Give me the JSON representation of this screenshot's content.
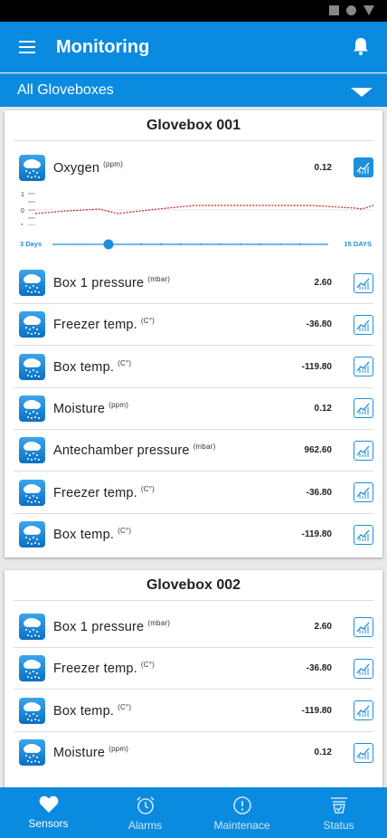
{
  "app": {
    "title": "Monitoring"
  },
  "filter": {
    "label": "All Gloveboxes"
  },
  "gloveboxes": [
    {
      "title": "Glovebox 001",
      "featured": {
        "name": "Oxygen",
        "unit": "(ppm)",
        "value": "0.12"
      },
      "graph": {
        "y_ticks": [
          "1",
          "0",
          "-1"
        ]
      },
      "slider": {
        "min_label": "3 Days",
        "max_label": "15 DAYS",
        "level": 0.2
      },
      "sensors": [
        {
          "name": "Box 1 pressure",
          "unit": "(mbar)",
          "value": "2.60"
        },
        {
          "name": "Freezer temp.",
          "unit": "(C°)",
          "value": "-36.80"
        },
        {
          "name": "Box temp.",
          "unit": "(C°)",
          "value": "-119.80"
        },
        {
          "name": "Moisture",
          "unit": "(ppm)",
          "value": "0.12"
        },
        {
          "name": "Antechamber pressure",
          "unit": "(mbar)",
          "value": "962.60"
        },
        {
          "name": "Freezer temp.",
          "unit": "(C°)",
          "value": "-36.80"
        },
        {
          "name": "Box temp.",
          "unit": "(C°)",
          "value": "-119.80"
        }
      ]
    },
    {
      "title": "Glovebox 002",
      "sensors": [
        {
          "name": "Box 1 pressure",
          "unit": "(mbar)",
          "value": "2.60"
        },
        {
          "name": "Freezer temp.",
          "unit": "(C°)",
          "value": "-36.80"
        },
        {
          "name": "Box temp.",
          "unit": "(C°)",
          "value": "-119.80"
        },
        {
          "name": "Moisture",
          "unit": "(ppm)",
          "value": "0.12"
        }
      ]
    }
  ],
  "nav": [
    {
      "label": "Sensors",
      "icon": "heart-icon"
    },
    {
      "label": "Alarms",
      "icon": "alarm-clock-icon"
    },
    {
      "label": "Maintenace",
      "icon": "alert-circle-icon"
    },
    {
      "label": "Status",
      "icon": "status-check-icon"
    }
  ],
  "colors": {
    "primary": "#0a8be0",
    "accent": "#1d8fdc",
    "graph_line": "#d11a1a"
  }
}
